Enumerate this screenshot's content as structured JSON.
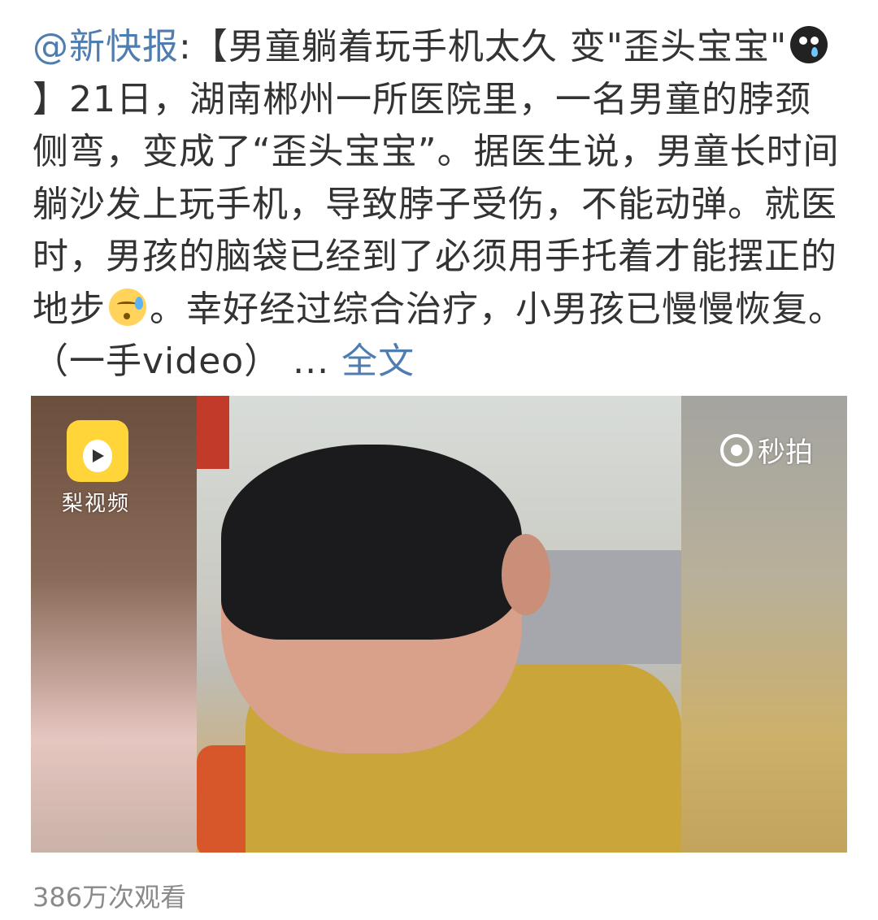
{
  "post": {
    "author": "@新快报",
    "text_part_1": ":【男童躺着玩手机太久 变\"歪头宝宝\"",
    "emoji_1": "cry-emoji",
    "text_part_2": "】21日，湖南郴州一所医院里，一名男童的脖颈侧弯，变成了“歪头宝宝”。据医生说，男童长时间躺沙发上玩手机，导致脖子受伤，不能动弹。就医时，男孩的脑袋已经到了必须用手托着才能摆正的地步",
    "emoji_2": "sweat-emoji",
    "text_part_3": "。幸好经过综合治疗，小男孩已慢慢恢复。（一手video） ... ",
    "full_text_link": "全文"
  },
  "video": {
    "source_logo_label": "梨视频",
    "watermark_label": "秒拍"
  },
  "stats": {
    "views": "386万次观看"
  },
  "colors": {
    "link": "#507daf",
    "text": "#333333",
    "muted": "#8a8a8a"
  }
}
